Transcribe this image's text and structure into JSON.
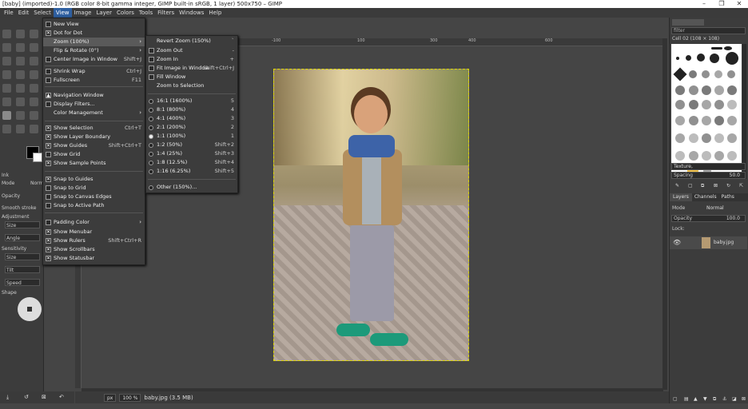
{
  "window": {
    "title": "[baby] (imported)-1.0 (RGB color 8-bit gamma integer, GIMP built-in sRGB, 1 layer) 500x750 – GIMP"
  },
  "menubar": [
    "File",
    "Edit",
    "Select",
    "View",
    "Image",
    "Layer",
    "Colors",
    "Tools",
    "Filters",
    "Windows",
    "Help"
  ],
  "view_menu": {
    "items": [
      {
        "label": "New View",
        "check": false
      },
      {
        "label": "Dot for Dot",
        "check": true
      },
      {
        "label": "Zoom (100%)",
        "submenu": true,
        "highlight": true
      },
      {
        "label": "Flip & Rotate (0°)",
        "submenu": true
      },
      {
        "label": "Center Image in Window",
        "accel": "Shift+J"
      },
      {
        "label": "Shrink Wrap",
        "accel": "Ctrl+J"
      },
      {
        "label": "Fullscreen",
        "accel": "F11"
      },
      {
        "label": "Navigation Window"
      },
      {
        "label": "Display Filters..."
      },
      {
        "label": "Color Management",
        "submenu": true
      },
      {
        "label": "Show Selection",
        "accel": "Ctrl+T",
        "check": true
      },
      {
        "label": "Show Layer Boundary",
        "check": true
      },
      {
        "label": "Show Guides",
        "accel": "Shift+Ctrl+T",
        "check": true
      },
      {
        "label": "Show Grid",
        "check": false
      },
      {
        "label": "Show Sample Points",
        "check": true
      },
      {
        "label": "Snap to Guides",
        "check": true
      },
      {
        "label": "Snap to Grid",
        "check": false
      },
      {
        "label": "Snap to Canvas Edges",
        "check": false
      },
      {
        "label": "Snap to Active Path",
        "check": false
      },
      {
        "label": "Padding Color",
        "submenu": true
      },
      {
        "label": "Show Menubar",
        "check": true
      },
      {
        "label": "Show Rulers",
        "accel": "Shift+Ctrl+R",
        "check": true
      },
      {
        "label": "Show Scrollbars",
        "check": true
      },
      {
        "label": "Show Statusbar",
        "check": true
      }
    ]
  },
  "zoom_menu": {
    "items": [
      {
        "label": "Revert Zoom (150%)",
        "accel": "`"
      },
      {
        "label": "Zoom Out",
        "accel": "-"
      },
      {
        "label": "Zoom In",
        "accel": "+"
      },
      {
        "label": "Fit Image in Window",
        "accel": "Shift+Ctrl+J"
      },
      {
        "label": "Fill Window"
      },
      {
        "label": "Zoom to Selection"
      },
      {
        "label": "16:1 (1600%)",
        "accel": "5",
        "radio": false
      },
      {
        "label": "8:1 (800%)",
        "accel": "4",
        "radio": false
      },
      {
        "label": "4:1 (400%)",
        "accel": "3",
        "radio": false
      },
      {
        "label": "2:1 (200%)",
        "accel": "2",
        "radio": false
      },
      {
        "label": "1:1 (100%)",
        "accel": "1",
        "radio": true
      },
      {
        "label": "1:2 (50%)",
        "accel": "Shift+2",
        "radio": false
      },
      {
        "label": "1:4 (25%)",
        "accel": "Shift+3",
        "radio": false
      },
      {
        "label": "1:8 (12.5%)",
        "accel": "Shift+4",
        "radio": false
      },
      {
        "label": "1:16 (6.25%)",
        "accel": "Shift+5",
        "radio": false
      },
      {
        "label": "Other (150%)...",
        "radio": false
      }
    ]
  },
  "tool_options": {
    "name": "Ink",
    "mode_label": "Mode",
    "mode_value": "Normal",
    "opacity_label": "Opacity",
    "smooth_label": "Smooth stroke",
    "adjustment_label": "Adjustment",
    "size_label": "Size",
    "angle_label": "Angle",
    "sensitivity_label": "Sensitivity",
    "size2_label": "Size",
    "tilt_label": "Tilt",
    "speed_label": "Speed",
    "shape_label": "Shape"
  },
  "statusbar": {
    "unit": "px",
    "zoom": "100 %",
    "info": "baby.jpg (3.5 MB)"
  },
  "rulers": {
    "h": [
      "-100",
      "0",
      "100",
      "200",
      "300",
      "400",
      "500",
      "600"
    ]
  },
  "right_panel": {
    "filter_placeholder": "filter",
    "brush_name": "Cell 02 (108 × 108)",
    "tag_value": "Texture,",
    "spacing_label": "Spacing",
    "spacing_value": "50.0",
    "tabs": [
      "Layers",
      "Channels",
      "Paths"
    ],
    "mode_label": "Mode",
    "mode_value": "Normal",
    "opacity_label": "Opacity",
    "opacity_value": "100.0",
    "lock_label": "Lock:",
    "layer_name": "baby.jpg"
  }
}
